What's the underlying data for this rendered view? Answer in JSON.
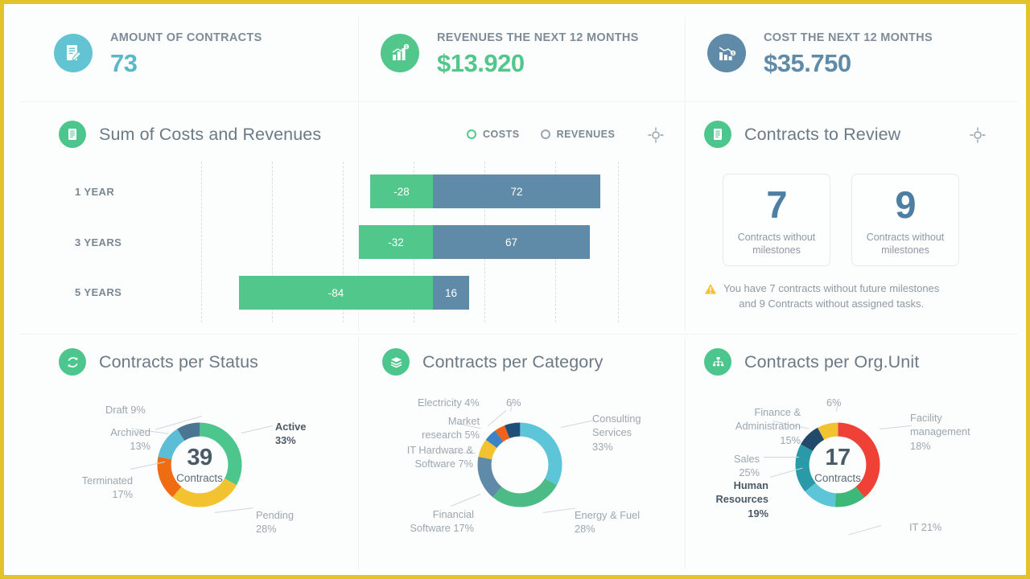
{
  "kpis": [
    {
      "label": "AMOUNT OF CONTRACTS",
      "value": "73",
      "value_color": "#5bb8c9",
      "icon_color": "#62c3d2",
      "icon": "contract-edit-icon"
    },
    {
      "label": "REVENUES THE NEXT 12 MONTHS",
      "value": "$13.920",
      "value_color": "#52c78c",
      "icon_color": "#52c78c",
      "icon": "revenue-chart-icon"
    },
    {
      "label": "COST THE NEXT 12  MONTHS",
      "value": "$35.750",
      "value_color": "#5f8aa8",
      "icon_color": "#5f8aa8",
      "icon": "cost-chart-icon"
    }
  ],
  "costs_revenues": {
    "title": "Sum of Costs and Revenues",
    "icon": "document-icon",
    "legend": [
      {
        "label": "COSTS",
        "color": "#52c78c"
      },
      {
        "label": "REVENUES",
        "color": "#9aa7b1"
      }
    ],
    "target_icon": "crosshair-icon"
  },
  "review": {
    "title": "Contracts to Review",
    "icon": "document-icon",
    "target_icon": "crosshair-icon",
    "tiles": [
      {
        "number": "7",
        "caption": "Contracts without milestones"
      },
      {
        "number": "9",
        "caption": "Contracts without milestones"
      }
    ],
    "warning_icon": "warning-triangle-icon",
    "warning_line1": "You have 7 contracts without  future  milestones",
    "warning_line2": "and 9 Contracts without  assigned tasks."
  },
  "status_panel": {
    "title": "Contracts per Status",
    "icon": "refresh-icon"
  },
  "category_panel": {
    "title": "Contracts per Category",
    "icon": "layers-icon"
  },
  "orgunit_panel": {
    "title": "Contracts per Org.Unit",
    "icon": "org-tree-icon"
  },
  "watermark": "",
  "chart_data": [
    {
      "type": "bar",
      "title": "Sum of Costs and Revenues",
      "orientation": "horizontal",
      "stacked": "diverging",
      "categories": [
        "1 YEAR",
        "3 YEARS",
        "5 YEARS"
      ],
      "xlabel": "",
      "ylabel": "",
      "grid": true,
      "xlim": [
        -120,
        120
      ],
      "series": [
        {
          "name": "COSTS",
          "color": "#52c78c",
          "values": [
            -28,
            -32,
            -84
          ]
        },
        {
          "name": "REVENUES",
          "color": "#5f8aa8",
          "values": [
            72,
            67,
            16
          ]
        }
      ]
    },
    {
      "type": "pie",
      "title": "Contracts per Status",
      "center_value": "39",
      "center_label": "Contracts",
      "labels": [
        "Active",
        "Pending",
        "Terminated",
        "Archived",
        "Draft"
      ],
      "values": [
        33,
        28,
        17,
        13,
        9
      ],
      "display": [
        "Active 33%",
        "Pending 28%",
        "Terminated 17%",
        "Archived 13%",
        "Draft 9%"
      ],
      "colors": [
        "#4cc68d",
        "#f2c230",
        "#f06c13",
        "#5cbed6",
        "#4a7693"
      ]
    },
    {
      "type": "pie",
      "title": "Contracts per Category",
      "center_value": "",
      "center_label": "",
      "labels": [
        "Consulting Services",
        "Energy & Fuel",
        "Financial Software",
        "IT Hardware & Software",
        "Market research",
        "Electricity",
        ""
      ],
      "values": [
        33,
        28,
        17,
        7,
        5,
        4,
        6
      ],
      "display": [
        "Consulting Services 33%",
        "Energy & Fuel 28%",
        "Financial Software 17%",
        "IT Hardware & Software 7%",
        "Market research 5%",
        "Electricity 4%",
        "6%"
      ],
      "colors": [
        "#5cc6d8",
        "#4cbb85",
        "#5f8aa8",
        "#f2c230",
        "#3d84c6",
        "#f2601a",
        "#1e4f78"
      ]
    },
    {
      "type": "pie",
      "title": "Contracts per Org.Unit",
      "center_value": "17",
      "center_label": "Contracts",
      "labels": [
        "Facility management",
        "IT",
        "Human Resources",
        "Sales",
        "Finance & Administration",
        ""
      ],
      "values": [
        18,
        21,
        19,
        25,
        15,
        6
      ],
      "display": [
        "Facility management 18%",
        "IT 21%",
        "Human Resources 19%",
        "Sales 25%",
        "Finance & Administration 15%",
        "6%"
      ],
      "colors": [
        "#ef4136",
        "#ef4136",
        "#3cb878",
        "#5cc6d8",
        "#2a9aa8",
        "#234a6b"
      ],
      "arc_colors": [
        "#ef4136",
        "#3cb878",
        "#5cc6d8",
        "#2a9aa8",
        "#234a6b",
        "#f2c230"
      ],
      "arc_values": [
        39,
        12,
        13,
        19,
        9,
        8
      ]
    }
  ],
  "status_labels": [
    {
      "text": "Draft 9%",
      "bold": false
    },
    {
      "text": "Archived",
      "bold": false
    },
    {
      "text": "13%",
      "bold": false
    },
    {
      "text": "Terminated",
      "bold": false
    },
    {
      "text": "17%",
      "bold": false
    },
    {
      "text": "Active",
      "bold": true
    },
    {
      "text": "33%",
      "bold": true
    },
    {
      "text": "Pending",
      "bold": false
    },
    {
      "text": "28%",
      "bold": false
    }
  ],
  "category_labels": [
    "Electricity 4%",
    "6%",
    "Market",
    "research 5%",
    "IT Hardware &",
    "Software 7%",
    "Consulting",
    "Services",
    "33%",
    "Financial",
    "Software 17%",
    "Energy & Fuel",
    "28%"
  ],
  "orgunit_labels": [
    "6%",
    "Finance &",
    "Administration",
    "15%",
    "Sales 25%",
    "Human",
    "Resources",
    "19%",
    "Facility",
    "management",
    "18%",
    "IT 21%"
  ]
}
